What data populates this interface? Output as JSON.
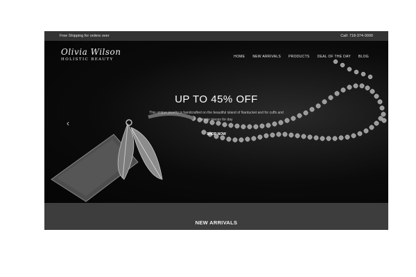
{
  "topbar": {
    "shipping": "Free Shipping for orders over",
    "phone": "Call: 718-374-0000"
  },
  "brand": {
    "name": "Olivia Wilson",
    "tagline": "HOLISTIC BEAUTY"
  },
  "nav": {
    "items": [
      "HOME",
      "NEW ARRIVALS",
      "PRODUCTS",
      "DEAL OF THE DAY",
      "BLOG"
    ]
  },
  "hero": {
    "headline": "UP TO 45% OFF",
    "description": "This unique jewelry is handcrafted on the beautiful island of Nantucket and for cuffs and simple pieces for day",
    "cta": "SHOP NOW",
    "prev_icon": "chevron-left-icon"
  },
  "section": {
    "title": "NEW ARRIVALS"
  }
}
